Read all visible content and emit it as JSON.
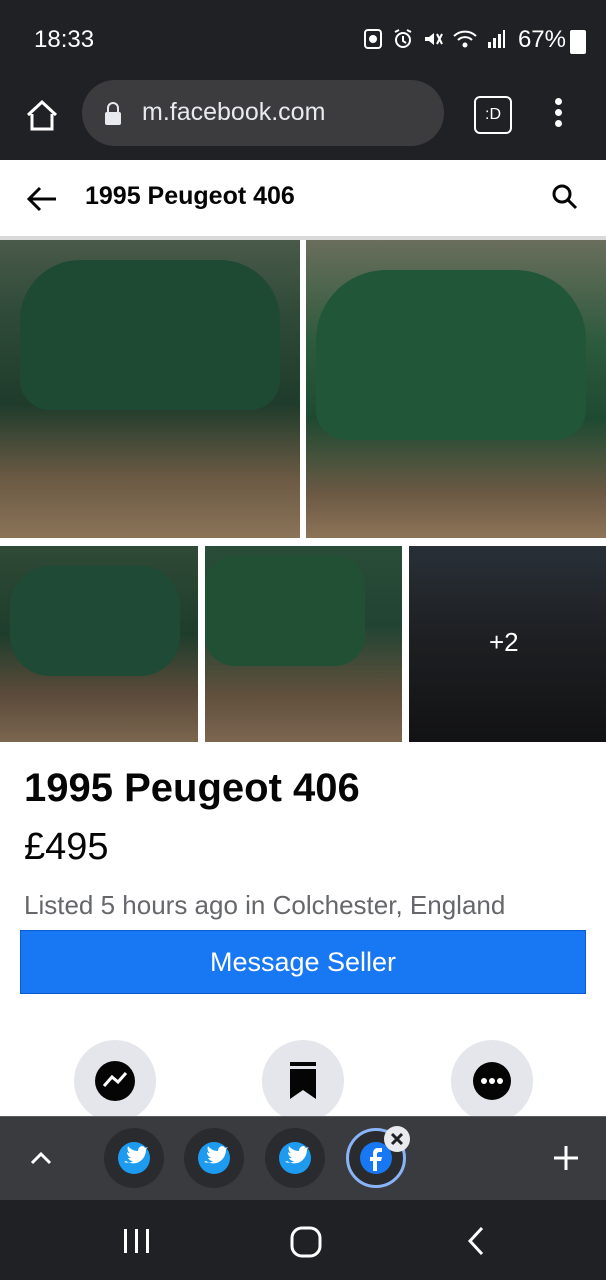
{
  "status_bar": {
    "time": "18:33",
    "battery": "67%",
    "icons": [
      "screenshot-icon",
      "alarm-icon",
      "mute-icon",
      "wifi-icon",
      "signal-icon",
      "battery-icon"
    ]
  },
  "browser": {
    "url": "m.facebook.com",
    "tabs_label": ":D"
  },
  "header": {
    "title": "1995 Peugeot 406"
  },
  "gallery": {
    "more_count": "+2"
  },
  "listing": {
    "title": "1995 Peugeot 406",
    "price": "£495",
    "meta": "Listed 5 hours ago in Colchester, England",
    "message_button": "Message Seller"
  },
  "actions": [
    "messenger-icon",
    "save-icon",
    "more-icon"
  ],
  "toolbar": {
    "tabs": [
      "twitter",
      "twitter",
      "twitter",
      "facebook"
    ]
  },
  "colors": {
    "accent": "#1877f2",
    "chrome_dark": "#202124",
    "toolbar": "#3a3b3f"
  }
}
